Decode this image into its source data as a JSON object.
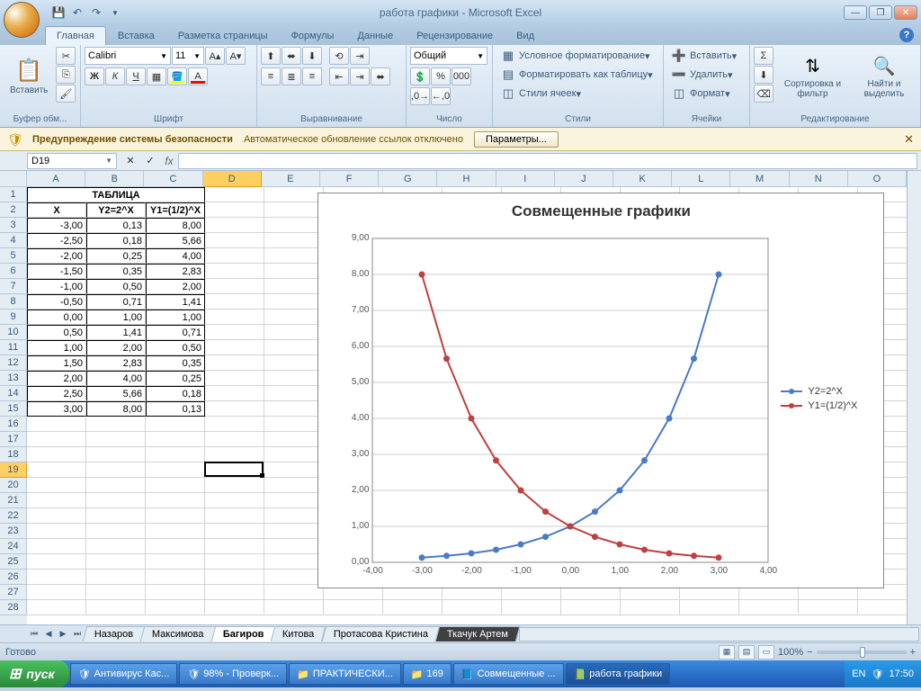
{
  "title": "работа графики - Microsoft Excel",
  "tabs": [
    "Главная",
    "Вставка",
    "Разметка страницы",
    "Формулы",
    "Данные",
    "Рецензирование",
    "Вид"
  ],
  "active_tab": 0,
  "ribbon": {
    "clipboard": {
      "label": "Буфер обм...",
      "paste": "Вставить"
    },
    "font": {
      "label": "Шрифт",
      "name": "Calibri",
      "size": "11"
    },
    "align": {
      "label": "Выравнивание"
    },
    "number": {
      "label": "Число",
      "format": "Общий"
    },
    "styles": {
      "label": "Стили",
      "cond": "Условное форматирование",
      "table": "Форматировать как таблицу",
      "cell": "Стили ячеек"
    },
    "cells": {
      "label": "Ячейки",
      "insert": "Вставить",
      "delete": "Удалить",
      "format": "Формат"
    },
    "editing": {
      "label": "Редактирование",
      "sort": "Сортировка и фильтр",
      "find": "Найти и выделить"
    }
  },
  "security": {
    "bold": "Предупреждение системы безопасности",
    "text": "Автоматическое обновление ссылок отключено",
    "button": "Параметры..."
  },
  "namebox": "D19",
  "columns": [
    "A",
    "B",
    "C",
    "D",
    "E",
    "F",
    "G",
    "H",
    "I",
    "J",
    "K",
    "L",
    "M",
    "N",
    "O"
  ],
  "rows": 28,
  "active_row": 19,
  "active_col": 3,
  "table": {
    "title": "ТАБЛИЦА",
    "headers": [
      "X",
      "Y2=2^X",
      "Y1=(1/2)^X"
    ],
    "data": [
      [
        "-3,00",
        "0,13",
        "8,00"
      ],
      [
        "-2,50",
        "0,18",
        "5,66"
      ],
      [
        "-2,00",
        "0,25",
        "4,00"
      ],
      [
        "-1,50",
        "0,35",
        "2,83"
      ],
      [
        "-1,00",
        "0,50",
        "2,00"
      ],
      [
        "-0,50",
        "0,71",
        "1,41"
      ],
      [
        "0,00",
        "1,00",
        "1,00"
      ],
      [
        "0,50",
        "1,41",
        "0,71"
      ],
      [
        "1,00",
        "2,00",
        "0,50"
      ],
      [
        "1,50",
        "2,83",
        "0,35"
      ],
      [
        "2,00",
        "4,00",
        "0,25"
      ],
      [
        "2,50",
        "5,66",
        "0,18"
      ],
      [
        "3,00",
        "8,00",
        "0,13"
      ]
    ]
  },
  "chart_data": {
    "type": "line",
    "title": "Совмещенные графики",
    "x": [
      -3.0,
      -2.5,
      -2.0,
      -1.5,
      -1.0,
      -0.5,
      0.0,
      0.5,
      1.0,
      1.5,
      2.0,
      2.5,
      3.0
    ],
    "series": [
      {
        "name": "Y2=2^X",
        "color": "#4a7ac8",
        "values": [
          0.13,
          0.18,
          0.25,
          0.35,
          0.5,
          0.71,
          1.0,
          1.41,
          2.0,
          2.83,
          4.0,
          5.66,
          8.0
        ]
      },
      {
        "name": "Y1=(1/2)^X",
        "color": "#c04040",
        "values": [
          8.0,
          5.66,
          4.0,
          2.83,
          2.0,
          1.41,
          1.0,
          0.71,
          0.5,
          0.35,
          0.25,
          0.18,
          0.13
        ]
      }
    ],
    "xlim": [
      -4,
      4
    ],
    "ylim": [
      0,
      9
    ],
    "xticks": [
      "-4,00",
      "-3,00",
      "-2,00",
      "-1,00",
      "0,00",
      "1,00",
      "2,00",
      "3,00",
      "4,00"
    ],
    "yticks": [
      "0,00",
      "1,00",
      "2,00",
      "3,00",
      "4,00",
      "5,00",
      "6,00",
      "7,00",
      "8,00",
      "9,00"
    ]
  },
  "sheets": [
    "Назаров",
    "Максимова",
    "Багиров",
    "Китова",
    "Протасова Кристина",
    "Ткачук Артем"
  ],
  "active_sheet": 2,
  "status": "Готово",
  "zoom": "100%",
  "taskbar": {
    "start": "пуск",
    "items": [
      "Антивирус Кас...",
      "98% - Проверк...",
      "ПРАКТИЧЕСКИ...",
      "169",
      "Совмещенные ...",
      "работа графики"
    ],
    "lang": "EN",
    "time": "17:50"
  }
}
